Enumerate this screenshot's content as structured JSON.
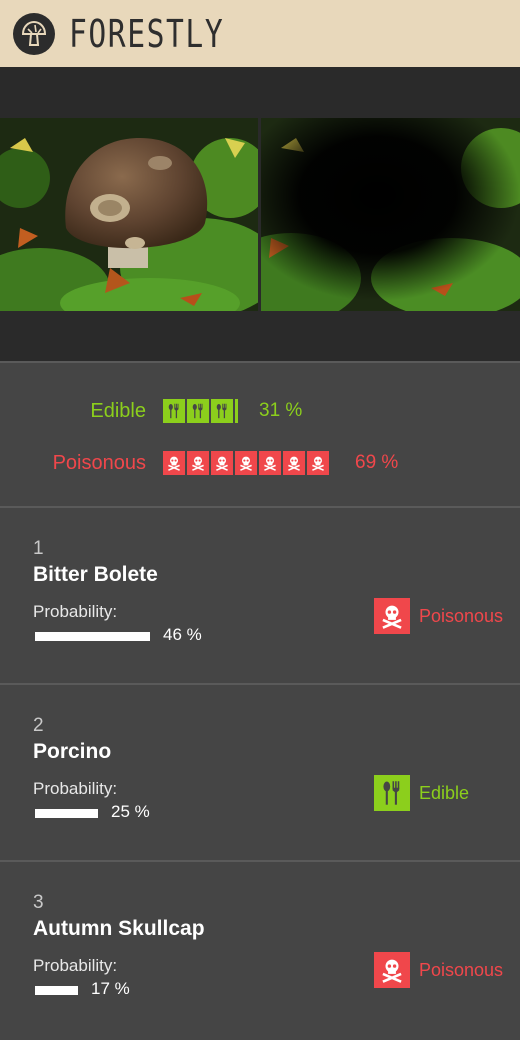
{
  "header": {
    "brand": "FORESTLY",
    "logo_icon": "mushroom-icon"
  },
  "photos": {
    "left": "mushroom-photo",
    "right": "mushroom-photo-masked"
  },
  "summary": {
    "edible": {
      "label": "Edible",
      "pct": "31 %",
      "fraction": 0.31,
      "icon": "utensils-icon",
      "color": "#8ccf1c"
    },
    "poisonous": {
      "label": "Poisonous",
      "pct": "69 %",
      "fraction": 0.69,
      "icon": "skull-crossbones-icon",
      "color": "#f0474b"
    }
  },
  "results": [
    {
      "rank": "1",
      "name": "Bitter Bolete",
      "prob_label": "Probability:",
      "prob": "46 %",
      "fraction": 0.46,
      "verdict": "Poisonous",
      "verdict_icon": "skull-crossbones-icon"
    },
    {
      "rank": "2",
      "name": "Porcino",
      "prob_label": "Probability:",
      "prob": "25 %",
      "fraction": 0.25,
      "verdict": "Edible",
      "verdict_icon": "utensils-icon"
    },
    {
      "rank": "3",
      "name": "Autumn Skullcap",
      "prob_label": "Probability:",
      "prob": "17 %",
      "fraction": 0.17,
      "verdict": "Poisonous",
      "verdict_icon": "skull-crossbones-icon"
    }
  ]
}
